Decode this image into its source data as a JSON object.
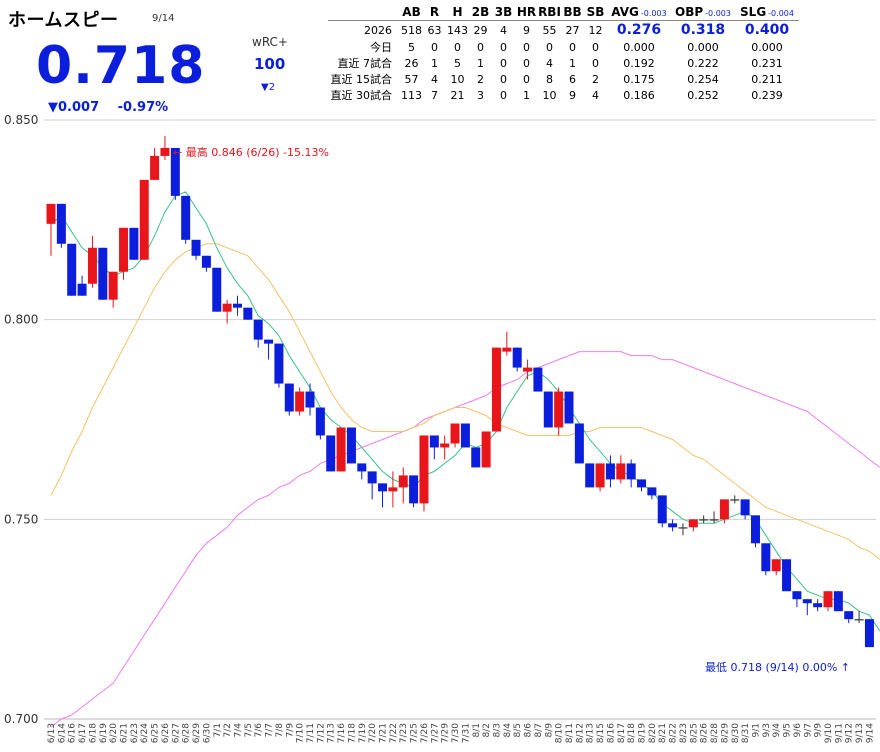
{
  "header": {
    "title": "ホームスピー",
    "date": "9/14",
    "value": "0.718",
    "change": "▼0.007",
    "change_pct": "-0.97%",
    "wrc_label": "wRC+",
    "wrc_value": "100",
    "wrc_change": "▼2"
  },
  "stats": {
    "columns": [
      "AB",
      "R",
      "H",
      "2B",
      "3B",
      "HR",
      "RBI",
      "BB",
      "SB"
    ],
    "rate_columns": [
      {
        "name": "AVG",
        "delta": "-0.003",
        "value": "0.276"
      },
      {
        "name": "OBP",
        "delta": "-0.003",
        "value": "0.318"
      },
      {
        "name": "SLG",
        "delta": "-0.004",
        "value": "0.400"
      }
    ],
    "season": {
      "label": "2026",
      "values": [
        "518",
        "63",
        "143",
        "29",
        "4",
        "9",
        "55",
        "27",
        "12"
      ]
    },
    "rows": [
      {
        "label": "今日",
        "values": [
          "5",
          "0",
          "0",
          "0",
          "0",
          "0",
          "0",
          "0",
          "0"
        ],
        "rates": [
          "0.000",
          "0.000",
          "0.000"
        ]
      },
      {
        "label": "直近 7試合",
        "values": [
          "26",
          "1",
          "5",
          "1",
          "0",
          "0",
          "4",
          "1",
          "0"
        ],
        "rates": [
          "0.192",
          "0.222",
          "0.231"
        ]
      },
      {
        "label": "直近 15試合",
        "values": [
          "57",
          "4",
          "10",
          "2",
          "0",
          "0",
          "8",
          "6",
          "2"
        ],
        "rates": [
          "0.175",
          "0.254",
          "0.211"
        ]
      },
      {
        "label": "直近 30試合",
        "values": [
          "113",
          "7",
          "21",
          "3",
          "0",
          "1",
          "10",
          "9",
          "4"
        ],
        "rates": [
          "0.186",
          "0.252",
          "0.239"
        ]
      }
    ]
  },
  "colors": {
    "accent": "#0a1edb",
    "up_candle": "#e8151b",
    "down_candle": "#0a1edb",
    "ma_short": "#3cc08a",
    "ma_mid": "#f5c26b",
    "ma_long": "#f07ef0",
    "grid": "#d0d0d0",
    "high_label": "#e8151b",
    "low_label": "#0a1edb"
  },
  "chart_data": {
    "type": "candlestick",
    "ylim": [
      0.7,
      0.85
    ],
    "yticks": [
      "0.700",
      "0.750",
      "0.800",
      "0.850"
    ],
    "high_annotation": "← 最高 0.846 (6/26) -15.13%",
    "low_annotation": "最低 0.718 (9/14) 0.00% ↑",
    "candles": [
      {
        "x": "6/13",
        "o": 0.824,
        "c": 0.829,
        "h": 0.829,
        "l": 0.816
      },
      {
        "x": "6/14",
        "o": 0.829,
        "c": 0.819,
        "h": 0.829,
        "l": 0.818
      },
      {
        "x": "6/16",
        "o": 0.819,
        "c": 0.806,
        "h": 0.819,
        "l": 0.806
      },
      {
        "x": "6/17",
        "o": 0.809,
        "c": 0.806,
        "h": 0.811,
        "l": 0.806
      },
      {
        "x": "6/18",
        "o": 0.809,
        "c": 0.818,
        "h": 0.821,
        "l": 0.808
      },
      {
        "x": "6/19",
        "o": 0.818,
        "c": 0.805,
        "h": 0.818,
        "l": 0.805
      },
      {
        "x": "6/20",
        "o": 0.805,
        "c": 0.812,
        "h": 0.812,
        "l": 0.803
      },
      {
        "x": "6/21",
        "o": 0.812,
        "c": 0.823,
        "h": 0.823,
        "l": 0.81
      },
      {
        "x": "6/23",
        "o": 0.823,
        "c": 0.815,
        "h": 0.823,
        "l": 0.815
      },
      {
        "x": "6/24",
        "o": 0.815,
        "c": 0.835,
        "h": 0.835,
        "l": 0.815
      },
      {
        "x": "6/25",
        "o": 0.835,
        "c": 0.841,
        "h": 0.843,
        "l": 0.835
      },
      {
        "x": "6/26",
        "o": 0.841,
        "c": 0.843,
        "h": 0.846,
        "l": 0.84
      },
      {
        "x": "6/27",
        "o": 0.843,
        "c": 0.831,
        "h": 0.843,
        "l": 0.83
      },
      {
        "x": "6/28",
        "o": 0.831,
        "c": 0.82,
        "h": 0.831,
        "l": 0.819
      },
      {
        "x": "6/29",
        "o": 0.82,
        "c": 0.816,
        "h": 0.82,
        "l": 0.815
      },
      {
        "x": "6/30",
        "o": 0.816,
        "c": 0.813,
        "h": 0.816,
        "l": 0.812
      },
      {
        "x": "7/1",
        "o": 0.813,
        "c": 0.802,
        "h": 0.813,
        "l": 0.802
      },
      {
        "x": "7/2",
        "o": 0.802,
        "c": 0.804,
        "h": 0.805,
        "l": 0.799
      },
      {
        "x": "7/4",
        "o": 0.804,
        "c": 0.803,
        "h": 0.806,
        "l": 0.801
      },
      {
        "x": "7/5",
        "o": 0.803,
        "c": 0.8,
        "h": 0.803,
        "l": 0.8
      },
      {
        "x": "7/6",
        "o": 0.8,
        "c": 0.795,
        "h": 0.8,
        "l": 0.793
      },
      {
        "x": "7/7",
        "o": 0.795,
        "c": 0.794,
        "h": 0.795,
        "l": 0.79
      },
      {
        "x": "7/8",
        "o": 0.794,
        "c": 0.784,
        "h": 0.794,
        "l": 0.783
      },
      {
        "x": "7/9",
        "o": 0.784,
        "c": 0.777,
        "h": 0.784,
        "l": 0.776
      },
      {
        "x": "7/10",
        "o": 0.777,
        "c": 0.782,
        "h": 0.783,
        "l": 0.776
      },
      {
        "x": "7/11",
        "o": 0.782,
        "c": 0.778,
        "h": 0.784,
        "l": 0.776
      },
      {
        "x": "7/12",
        "o": 0.778,
        "c": 0.771,
        "h": 0.778,
        "l": 0.77
      },
      {
        "x": "7/13",
        "o": 0.771,
        "c": 0.762,
        "h": 0.771,
        "l": 0.762
      },
      {
        "x": "7/16",
        "o": 0.762,
        "c": 0.773,
        "h": 0.773,
        "l": 0.762
      },
      {
        "x": "7/18",
        "o": 0.773,
        "c": 0.764,
        "h": 0.773,
        "l": 0.764
      },
      {
        "x": "7/19",
        "o": 0.764,
        "c": 0.762,
        "h": 0.764,
        "l": 0.76
      },
      {
        "x": "7/20",
        "o": 0.762,
        "c": 0.759,
        "h": 0.762,
        "l": 0.755
      },
      {
        "x": "7/21",
        "o": 0.759,
        "c": 0.757,
        "h": 0.759,
        "l": 0.753
      },
      {
        "x": "7/22",
        "o": 0.757,
        "c": 0.758,
        "h": 0.762,
        "l": 0.753
      },
      {
        "x": "7/23",
        "o": 0.758,
        "c": 0.761,
        "h": 0.763,
        "l": 0.754
      },
      {
        "x": "7/25",
        "o": 0.761,
        "c": 0.754,
        "h": 0.761,
        "l": 0.753
      },
      {
        "x": "7/26",
        "o": 0.754,
        "c": 0.771,
        "h": 0.771,
        "l": 0.752
      },
      {
        "x": "7/27",
        "o": 0.771,
        "c": 0.768,
        "h": 0.771,
        "l": 0.765
      },
      {
        "x": "7/29",
        "o": 0.768,
        "c": 0.769,
        "h": 0.771,
        "l": 0.765
      },
      {
        "x": "7/30",
        "o": 0.769,
        "c": 0.774,
        "h": 0.774,
        "l": 0.768
      },
      {
        "x": "7/31",
        "o": 0.774,
        "c": 0.768,
        "h": 0.774,
        "l": 0.768
      },
      {
        "x": "8/1",
        "o": 0.768,
        "c": 0.763,
        "h": 0.768,
        "l": 0.763
      },
      {
        "x": "8/2",
        "o": 0.763,
        "c": 0.772,
        "h": 0.772,
        "l": 0.763
      },
      {
        "x": "8/3",
        "o": 0.772,
        "c": 0.793,
        "h": 0.793,
        "l": 0.772
      },
      {
        "x": "8/4",
        "o": 0.792,
        "c": 0.793,
        "h": 0.797,
        "l": 0.791
      },
      {
        "x": "8/5",
        "o": 0.793,
        "c": 0.788,
        "h": 0.793,
        "l": 0.787
      },
      {
        "x": "8/6",
        "o": 0.787,
        "c": 0.788,
        "h": 0.79,
        "l": 0.785
      },
      {
        "x": "8/7",
        "o": 0.788,
        "c": 0.782,
        "h": 0.788,
        "l": 0.782
      },
      {
        "x": "8/9",
        "o": 0.782,
        "c": 0.773,
        "h": 0.782,
        "l": 0.773
      },
      {
        "x": "8/10",
        "o": 0.773,
        "c": 0.782,
        "h": 0.783,
        "l": 0.771
      },
      {
        "x": "8/11",
        "o": 0.782,
        "c": 0.774,
        "h": 0.782,
        "l": 0.774
      },
      {
        "x": "8/12",
        "o": 0.774,
        "c": 0.764,
        "h": 0.774,
        "l": 0.764
      },
      {
        "x": "8/13",
        "o": 0.764,
        "c": 0.758,
        "h": 0.764,
        "l": 0.758
      },
      {
        "x": "8/15",
        "o": 0.758,
        "c": 0.764,
        "h": 0.764,
        "l": 0.757
      },
      {
        "x": "8/16",
        "o": 0.764,
        "c": 0.76,
        "h": 0.766,
        "l": 0.758
      },
      {
        "x": "8/17",
        "o": 0.76,
        "c": 0.764,
        "h": 0.766,
        "l": 0.759
      },
      {
        "x": "8/18",
        "o": 0.764,
        "c": 0.76,
        "h": 0.765,
        "l": 0.758
      },
      {
        "x": "8/19",
        "o": 0.76,
        "c": 0.758,
        "h": 0.76,
        "l": 0.757
      },
      {
        "x": "8/20",
        "o": 0.758,
        "c": 0.756,
        "h": 0.758,
        "l": 0.755
      },
      {
        "x": "8/21",
        "o": 0.756,
        "c": 0.749,
        "h": 0.756,
        "l": 0.748
      },
      {
        "x": "8/22",
        "o": 0.749,
        "c": 0.748,
        "h": 0.75,
        "l": 0.747
      },
      {
        "x": "8/23",
        "o": 0.748,
        "c": 0.748,
        "h": 0.749,
        "l": 0.746
      },
      {
        "x": "8/25",
        "o": 0.748,
        "c": 0.75,
        "h": 0.75,
        "l": 0.747
      },
      {
        "x": "8/26",
        "o": 0.75,
        "c": 0.75,
        "h": 0.751,
        "l": 0.749
      },
      {
        "x": "8/28",
        "o": 0.75,
        "c": 0.75,
        "h": 0.752,
        "l": 0.749
      },
      {
        "x": "8/29",
        "o": 0.75,
        "c": 0.755,
        "h": 0.755,
        "l": 0.749
      },
      {
        "x": "8/30",
        "o": 0.755,
        "c": 0.755,
        "h": 0.756,
        "l": 0.754
      },
      {
        "x": "8/31",
        "o": 0.755,
        "c": 0.751,
        "h": 0.755,
        "l": 0.75
      },
      {
        "x": "9/1",
        "o": 0.751,
        "c": 0.744,
        "h": 0.751,
        "l": 0.743
      },
      {
        "x": "9/3",
        "o": 0.744,
        "c": 0.737,
        "h": 0.744,
        "l": 0.736
      },
      {
        "x": "9/4",
        "o": 0.737,
        "c": 0.74,
        "h": 0.74,
        "l": 0.736
      },
      {
        "x": "9/5",
        "o": 0.74,
        "c": 0.732,
        "h": 0.74,
        "l": 0.732
      },
      {
        "x": "9/6",
        "o": 0.732,
        "c": 0.73,
        "h": 0.732,
        "l": 0.728
      },
      {
        "x": "9/7",
        "o": 0.73,
        "c": 0.729,
        "h": 0.73,
        "l": 0.726
      },
      {
        "x": "9/9",
        "o": 0.729,
        "c": 0.728,
        "h": 0.73,
        "l": 0.727
      },
      {
        "x": "9/10",
        "o": 0.728,
        "c": 0.732,
        "h": 0.732,
        "l": 0.727
      },
      {
        "x": "9/11",
        "o": 0.732,
        "c": 0.727,
        "h": 0.732,
        "l": 0.727
      },
      {
        "x": "9/12",
        "o": 0.727,
        "c": 0.725,
        "h": 0.727,
        "l": 0.724
      },
      {
        "x": "9/13",
        "o": 0.725,
        "c": 0.725,
        "h": 0.727,
        "l": 0.724
      },
      {
        "x": "9/14",
        "o": 0.725,
        "c": 0.718,
        "h": 0.725,
        "l": 0.718
      }
    ],
    "ma_short_values": [
      0.824,
      0.826,
      0.822,
      0.818,
      0.816,
      0.813,
      0.811,
      0.812,
      0.813,
      0.816,
      0.821,
      0.827,
      0.831,
      0.832,
      0.828,
      0.824,
      0.818,
      0.813,
      0.809,
      0.806,
      0.801,
      0.799,
      0.796,
      0.791,
      0.787,
      0.783,
      0.778,
      0.775,
      0.773,
      0.771,
      0.768,
      0.765,
      0.762,
      0.76,
      0.759,
      0.758,
      0.761,
      0.762,
      0.764,
      0.766,
      0.769,
      0.768,
      0.769,
      0.772,
      0.778,
      0.782,
      0.786,
      0.787,
      0.785,
      0.782,
      0.778,
      0.774,
      0.77,
      0.767,
      0.764,
      0.762,
      0.761,
      0.759,
      0.757,
      0.754,
      0.752,
      0.75,
      0.749,
      0.749,
      0.749,
      0.75,
      0.751,
      0.752,
      0.75,
      0.746,
      0.742,
      0.738,
      0.735,
      0.732,
      0.731,
      0.73,
      0.73,
      0.729,
      0.727,
      0.726,
      0.722
    ],
    "ma_mid_values": [
      0.756,
      0.761,
      0.767,
      0.772,
      0.778,
      0.783,
      0.788,
      0.793,
      0.798,
      0.803,
      0.808,
      0.812,
      0.815,
      0.817,
      0.818,
      0.819,
      0.819,
      0.818,
      0.817,
      0.816,
      0.813,
      0.81,
      0.806,
      0.802,
      0.797,
      0.792,
      0.787,
      0.782,
      0.778,
      0.775,
      0.773,
      0.772,
      0.772,
      0.772,
      0.772,
      0.773,
      0.774,
      0.776,
      0.777,
      0.778,
      0.778,
      0.777,
      0.776,
      0.774,
      0.773,
      0.772,
      0.771,
      0.771,
      0.771,
      0.771,
      0.771,
      0.772,
      0.772,
      0.773,
      0.773,
      0.773,
      0.773,
      0.773,
      0.772,
      0.771,
      0.77,
      0.768,
      0.766,
      0.765,
      0.763,
      0.761,
      0.759,
      0.757,
      0.755,
      0.753,
      0.752,
      0.751,
      0.75,
      0.749,
      0.748,
      0.747,
      0.746,
      0.745,
      0.743,
      0.742,
      0.74
    ],
    "ma_long_values": [
      0.698,
      0.7,
      0.701,
      0.703,
      0.705,
      0.707,
      0.709,
      0.713,
      0.717,
      0.721,
      0.725,
      0.729,
      0.733,
      0.737,
      0.741,
      0.744,
      0.746,
      0.748,
      0.751,
      0.753,
      0.755,
      0.756,
      0.758,
      0.759,
      0.761,
      0.762,
      0.764,
      0.765,
      0.766,
      0.767,
      0.768,
      0.769,
      0.77,
      0.771,
      0.772,
      0.773,
      0.775,
      0.776,
      0.777,
      0.778,
      0.779,
      0.78,
      0.781,
      0.783,
      0.784,
      0.785,
      0.787,
      0.788,
      0.789,
      0.79,
      0.791,
      0.792,
      0.792,
      0.792,
      0.792,
      0.792,
      0.791,
      0.791,
      0.791,
      0.79,
      0.79,
      0.789,
      0.788,
      0.787,
      0.786,
      0.785,
      0.784,
      0.783,
      0.782,
      0.781,
      0.78,
      0.779,
      0.778,
      0.777,
      0.775,
      0.773,
      0.771,
      0.769,
      0.767,
      0.765,
      0.763
    ]
  }
}
